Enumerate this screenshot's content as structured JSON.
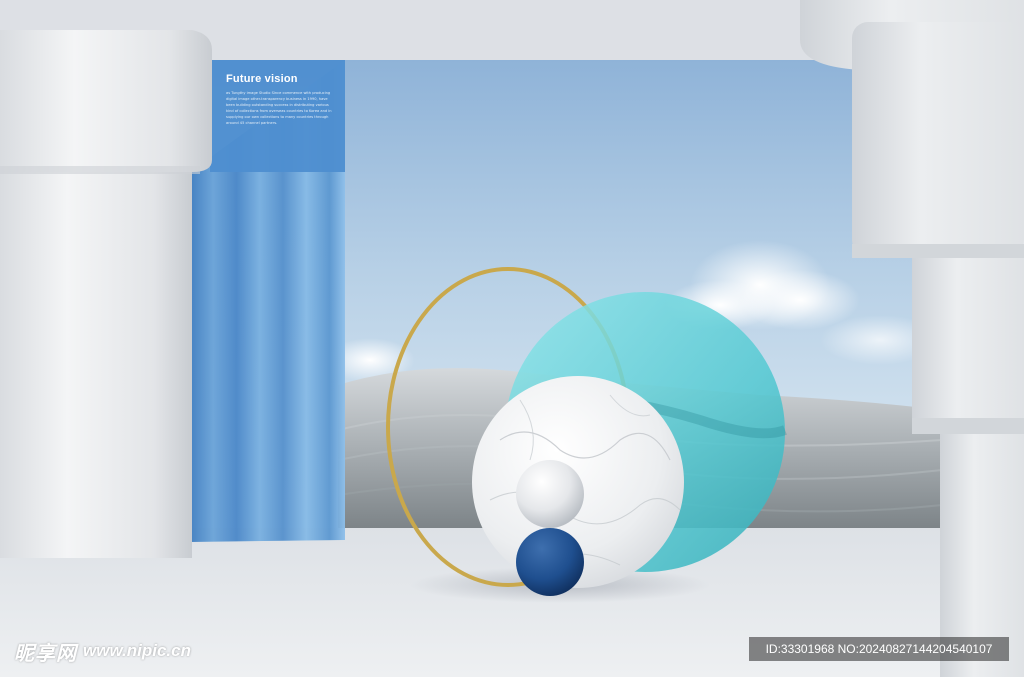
{
  "caption": {
    "title": "Future vision",
    "body": "as Tungthy image Studio Since commence with producing digital image other-transparency business in 1990, have been building outstanding success in distributing various kind of collections from overseas countries to Korea and in supplying our own collections to many countries through around 45 channel partners."
  },
  "watermark": {
    "logo_cn": "昵享网",
    "logo_url": "www.nipic.cn",
    "id_text": "ID:33301968 NO:20240827144204540107"
  },
  "colors": {
    "sky_top": "#8fb3d8",
    "sky_bottom": "#e1ecf4",
    "curtain": "#5b95cf",
    "teal_disc": "#5fd2d8",
    "navy_sphere": "#1f4f8f",
    "gold_ring": "#c9a84c",
    "wall": "#e7e9ed"
  }
}
